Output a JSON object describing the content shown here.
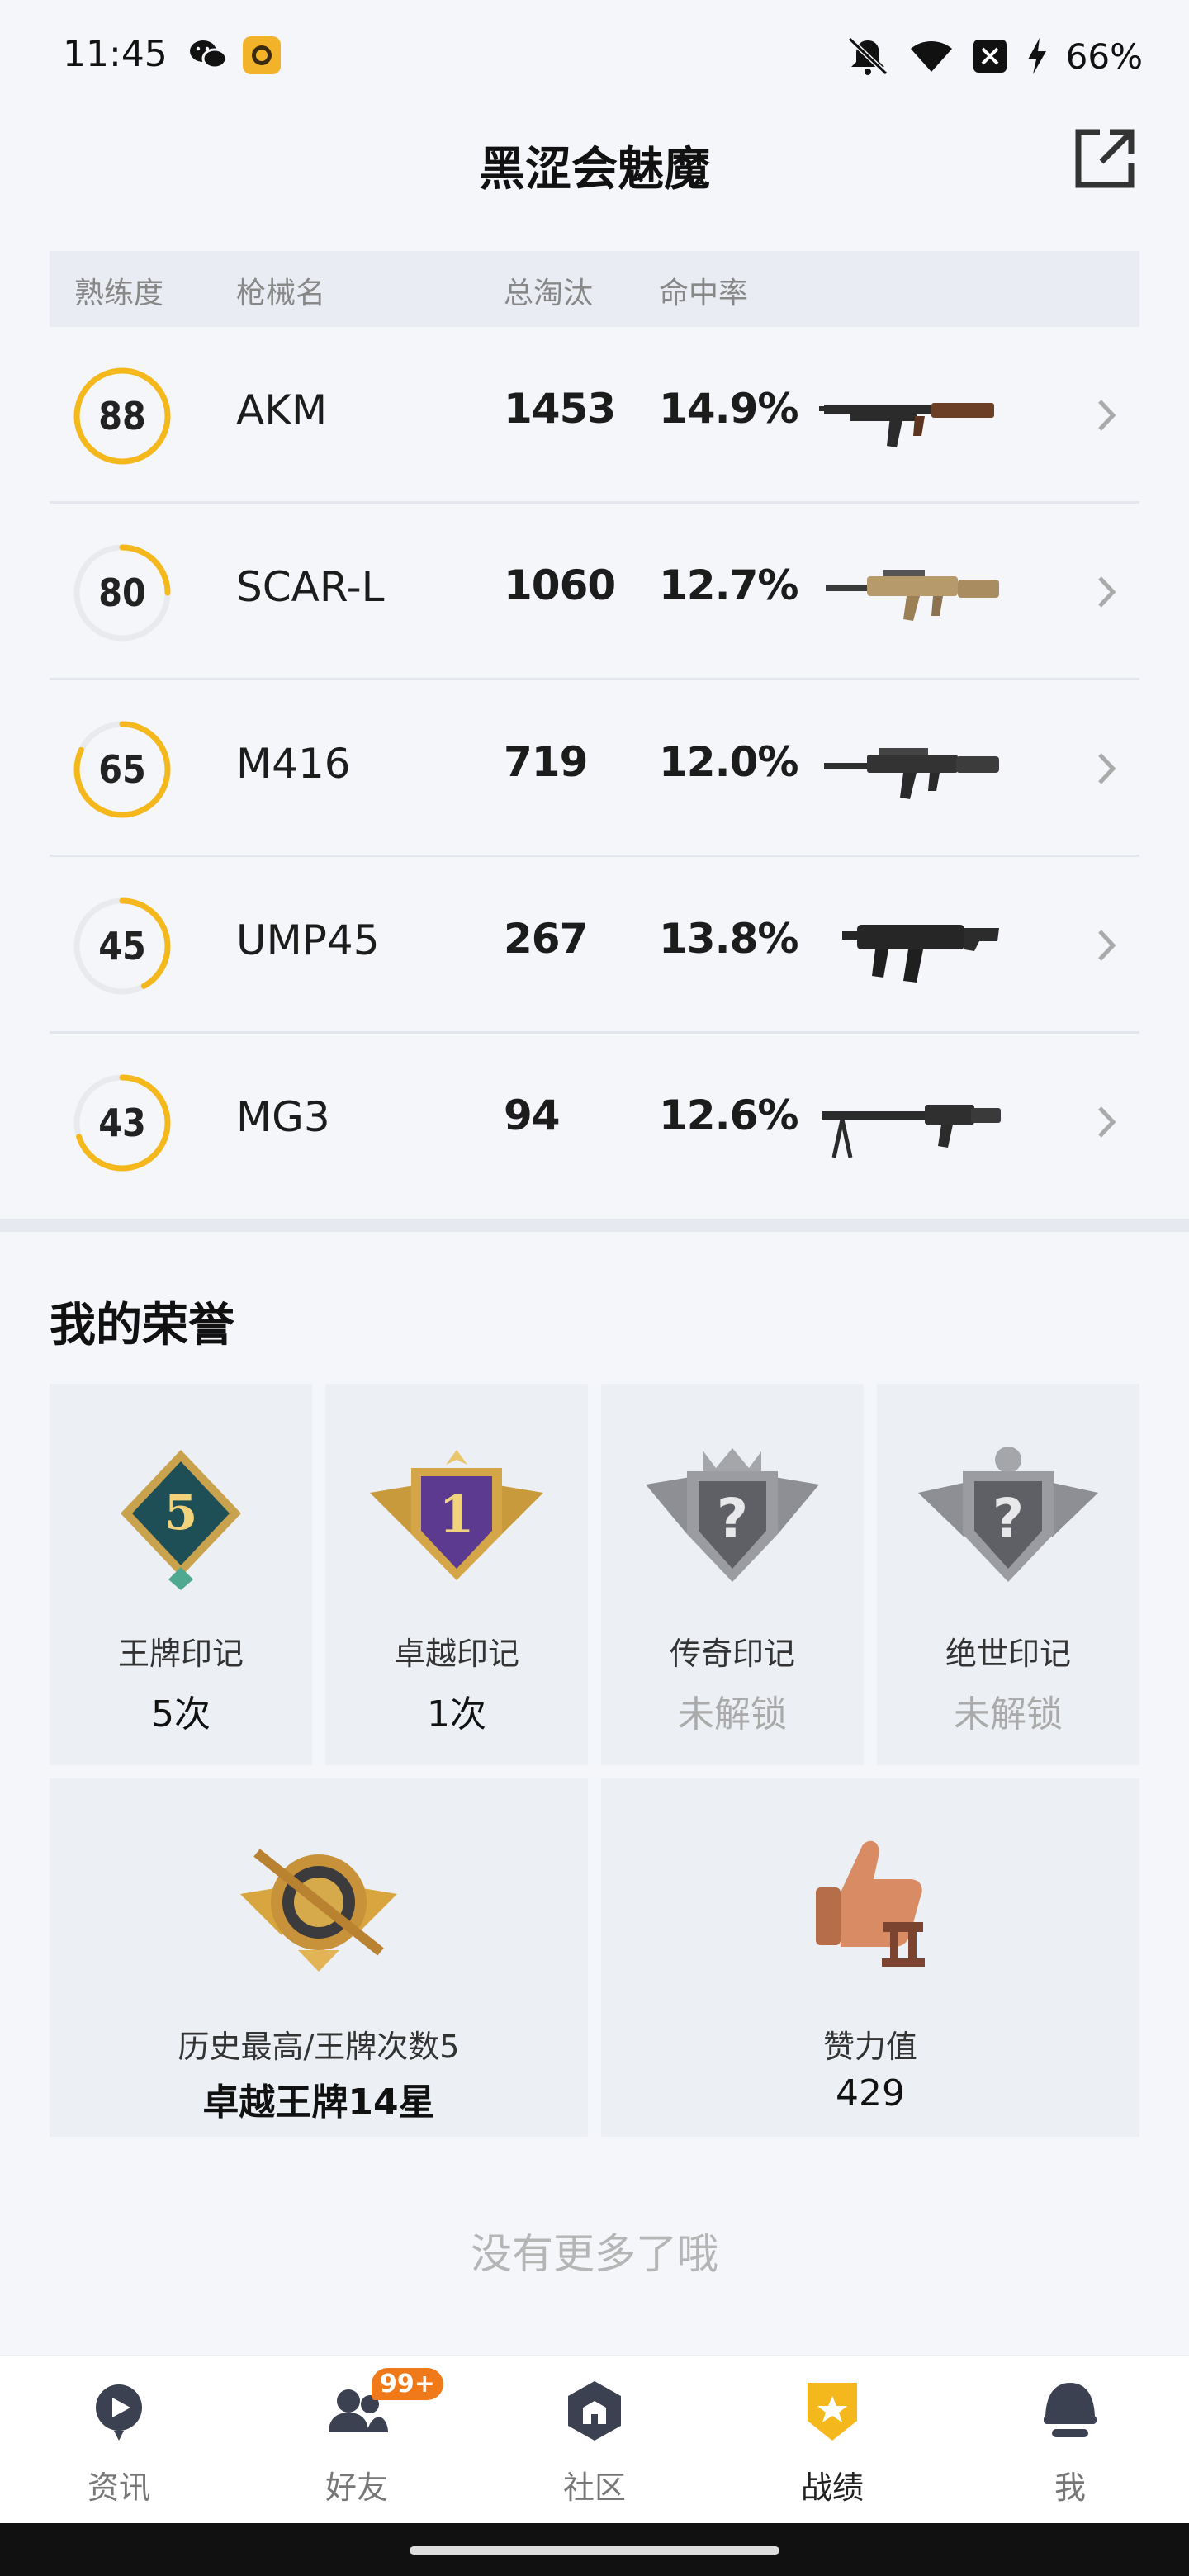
{
  "status_bar": {
    "time": "11:45",
    "battery": "66%"
  },
  "header": {
    "title": "黑涩会魅魔"
  },
  "table": {
    "columns": [
      "熟练度",
      "枪械名",
      "总淘汰",
      "命中率"
    ],
    "rows": [
      {
        "mastery": "88",
        "mastery_level": 1.0,
        "name": "AKM",
        "kills": "1453",
        "hit_rate": "14.9%"
      },
      {
        "mastery": "80",
        "mastery_level": 0.25,
        "name": "SCAR-L",
        "kills": "1060",
        "hit_rate": "12.7%"
      },
      {
        "mastery": "65",
        "mastery_level": 0.82,
        "name": "M416",
        "kills": "719",
        "hit_rate": "12.0%"
      },
      {
        "mastery": "45",
        "mastery_level": 0.42,
        "name": "UMP45",
        "kills": "267",
        "hit_rate": "13.8%"
      },
      {
        "mastery": "43",
        "mastery_level": 0.7,
        "name": "MG3",
        "kills": "94",
        "hit_rate": "12.6%"
      }
    ]
  },
  "honor": {
    "title": "我的荣誉",
    "badges": [
      {
        "label": "王牌印记",
        "value": "5次",
        "icon_text": "5",
        "locked": false
      },
      {
        "label": "卓越印记",
        "value": "1次",
        "icon_text": "1",
        "locked": false
      },
      {
        "label": "传奇印记",
        "value": "未解锁",
        "icon_text": "?",
        "locked": true
      },
      {
        "label": "绝世印记",
        "value": "未解锁",
        "icon_text": "?",
        "locked": true
      }
    ],
    "highest": {
      "label": "历史最高/王牌次数5",
      "value": "卓越王牌14星"
    },
    "likes": {
      "label": "赞力值",
      "value": "429"
    }
  },
  "footer_text": "没有更多了哦",
  "nav": {
    "items": [
      {
        "label": "资讯",
        "icon": "news-icon"
      },
      {
        "label": "好友",
        "icon": "friends-icon",
        "badge": "99+"
      },
      {
        "label": "社区",
        "icon": "community-icon"
      },
      {
        "label": "战绩",
        "icon": "record-icon",
        "active": true
      },
      {
        "label": "我",
        "icon": "me-icon"
      }
    ]
  },
  "colors": {
    "accent": "#f5b81c",
    "ring_track": "#e8eaee"
  }
}
